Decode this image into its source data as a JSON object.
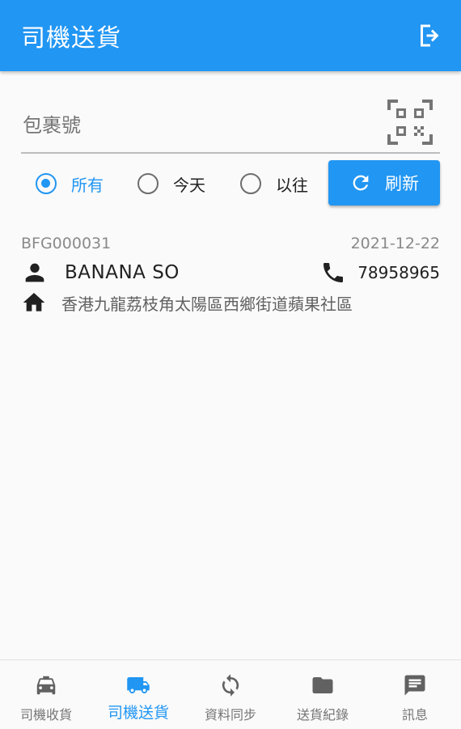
{
  "appbar": {
    "title": "司機送貨",
    "logout_icon": "logout-icon"
  },
  "search": {
    "placeholder": "包裹號",
    "value": "",
    "scan_icon": "qr-scan-icon"
  },
  "filters": {
    "options": [
      {
        "label": "所有",
        "selected": true
      },
      {
        "label": "今天",
        "selected": false
      },
      {
        "label": "以往",
        "selected": false
      }
    ],
    "refresh_label": "刷新"
  },
  "deliveries": [
    {
      "parcel_id": "BFG000031",
      "date": "2021-12-22",
      "recipient": "BANANA SO",
      "phone": "78958965",
      "address": "香港九龍荔枝角太陽區西鄉街道蘋果社區"
    }
  ],
  "bottom_nav": {
    "items": [
      {
        "label": "司機收貨",
        "icon": "taxi-icon",
        "active": false
      },
      {
        "label": "司機送貨",
        "icon": "truck-icon",
        "active": true
      },
      {
        "label": "資料同步",
        "icon": "sync-icon",
        "active": false
      },
      {
        "label": "送貨紀錄",
        "icon": "folder-icon",
        "active": false
      },
      {
        "label": "訊息",
        "icon": "message-icon",
        "active": false
      }
    ]
  },
  "colors": {
    "primary": "#2196f3",
    "inactive": "#757575",
    "icon_dark": "#212121"
  }
}
